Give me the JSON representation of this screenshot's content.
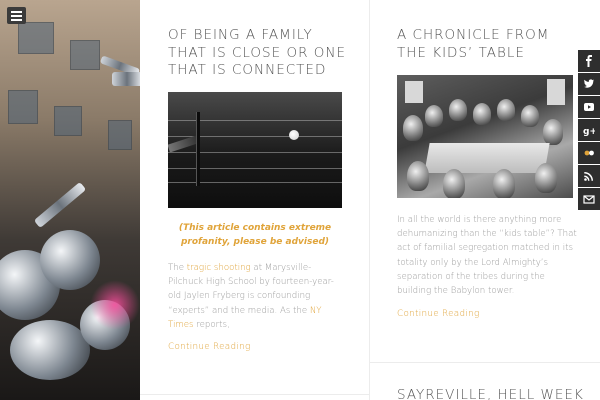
{
  "posts": [
    {
      "title": "Of being a family that is close or one that is connected",
      "notice": "(This article contains extreme profanity, please be advised)",
      "body": {
        "p1": "The ",
        "link1": "tragic shooting",
        "p2": " at Marysville-Pilchuck High School by fourteen-year-old Jaylen Fryberg is confounding “experts” and the media. As the ",
        "link2": "NY Times",
        "p3": " reports,"
      },
      "continue": "Continue Reading"
    },
    {
      "title": "A chronicle from the kids’ table",
      "body": "In all the world is there anything more dehumanizing than the “kids table”? That act of familial segregation matched in its totality only by the Lord Almighty’s separation of the tribes during the building the Babylon tower.",
      "continue": "Continue Reading"
    },
    {
      "title": "Sayreville, Hell Week"
    }
  ],
  "social": [
    "facebook-icon",
    "twitter-icon",
    "youtube-icon",
    "google-plus-icon",
    "flickr-icon",
    "rss-icon",
    "email-icon"
  ],
  "colors": {
    "accent": "#e0a43a",
    "text": "#9a9a9a",
    "title": "#555555",
    "social_bg": "#2e2e2e"
  }
}
